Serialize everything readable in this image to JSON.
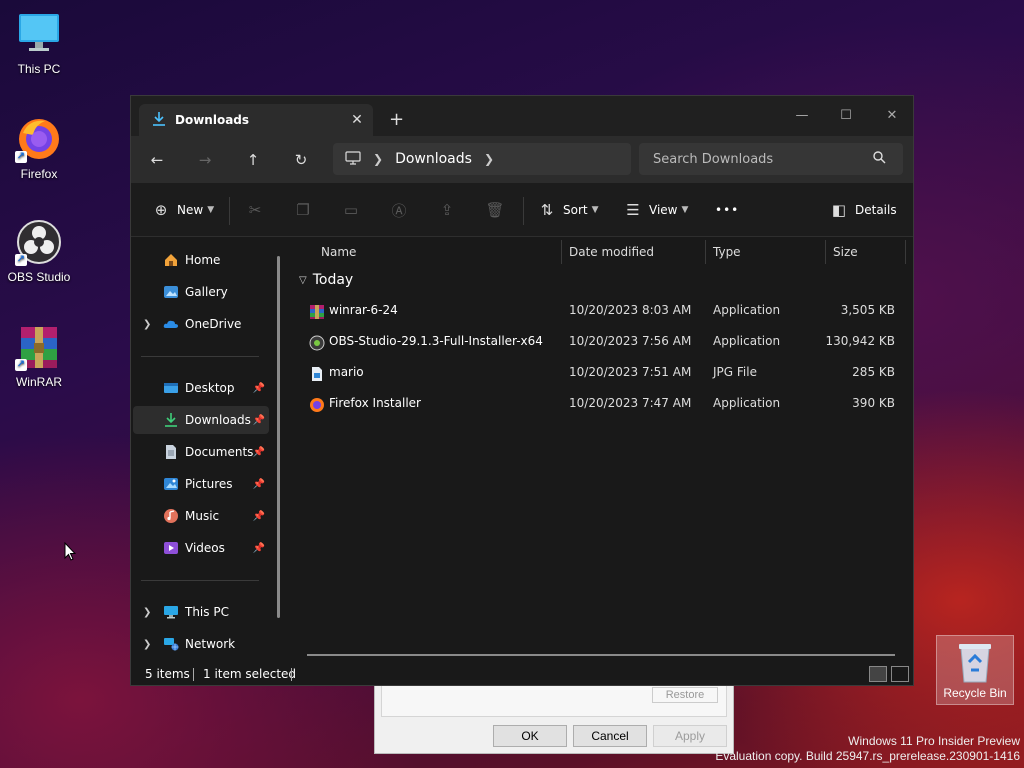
{
  "desktop": {
    "icons": [
      {
        "label": "This PC",
        "icon": "monitor-icon"
      },
      {
        "label": "Firefox",
        "icon": "firefox-icon"
      },
      {
        "label": "OBS Studio",
        "icon": "obs-icon"
      },
      {
        "label": "WinRAR",
        "icon": "winrar-icon"
      }
    ],
    "recycle_bin": "Recycle Bin",
    "watermark_line1": "Windows 11 Pro Insider Preview",
    "watermark_line2": "Evaluation copy. Build 25947.rs_prerelease.230901-1416"
  },
  "bg_dialog": {
    "restore": "Restore",
    "ok": "OK",
    "cancel": "Cancel",
    "apply": "Apply"
  },
  "explorer": {
    "tab_title": "Downloads",
    "address_current": "Downloads",
    "search_placeholder": "Search Downloads",
    "commands": {
      "new": "New",
      "sort": "Sort",
      "view": "View",
      "more": "•••",
      "details": "Details"
    },
    "sidebar": {
      "home": "Home",
      "gallery": "Gallery",
      "onedrive": "OneDrive",
      "desktop": "Desktop",
      "downloads": "Downloads",
      "documents": "Documents",
      "pictures": "Pictures",
      "music": "Music",
      "videos": "Videos",
      "this_pc": "This PC",
      "network": "Network"
    },
    "columns": {
      "name": "Name",
      "date": "Date modified",
      "type": "Type",
      "size": "Size"
    },
    "group": "Today",
    "files": [
      {
        "name": "winrar-6-24",
        "date": "10/20/2023 8:03 AM",
        "type": "Application",
        "size": "3,505 KB"
      },
      {
        "name": "OBS-Studio-29.1.3-Full-Installer-x64",
        "date": "10/20/2023 7:56 AM",
        "type": "Application",
        "size": "130,942 KB"
      },
      {
        "name": "mario",
        "date": "10/20/2023 7:51 AM",
        "type": "JPG File",
        "size": "285 KB"
      },
      {
        "name": "Firefox Installer",
        "date": "10/20/2023 7:47 AM",
        "type": "Application",
        "size": "390 KB"
      }
    ],
    "status": {
      "items": "5 items",
      "selected": "1 item selected"
    }
  },
  "colors": {
    "accent": "#4cc2ff",
    "window_bg": "#191919",
    "toolbar_bg": "#2c2c2c"
  }
}
